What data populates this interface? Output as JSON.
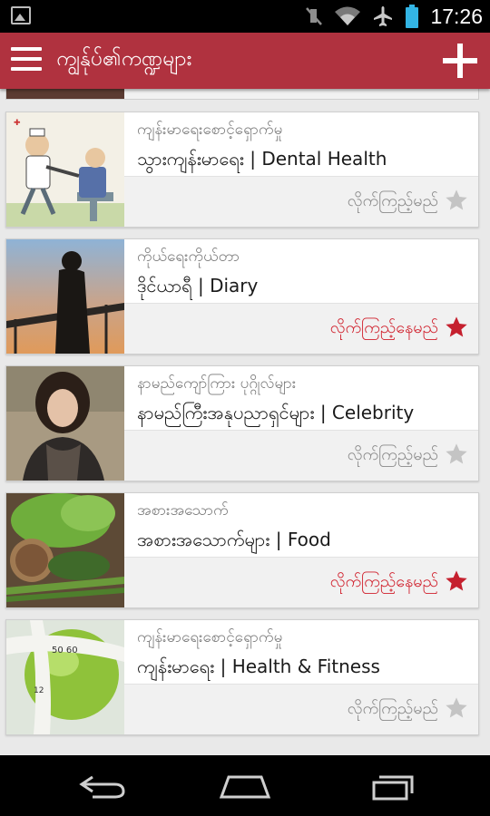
{
  "status_bar": {
    "time": "17:26",
    "icons": [
      "image-icon",
      "mute-icon",
      "wifi-icon",
      "airplane-icon",
      "battery-icon"
    ]
  },
  "app_bar": {
    "title": "ကျွန်ုပ်၏ကဏ္ဍများ",
    "menu_icon": "hamburger-menu-icon",
    "add_icon": "plus-icon"
  },
  "colors": {
    "accent": "#b0323f",
    "followed": "#d0202c",
    "unfollowed": "#8a8a8a",
    "star_on": "#c5202e",
    "star_off": "#c4c4c4"
  },
  "cards": [
    {
      "category": "ကျန်းမာရေးစောင့်ရှောက်မှု",
      "title": "သွားကျန်းမာရေး | Dental Health",
      "action": "လိုက်ကြည့်မည်",
      "starred": false,
      "thumbnail": "dentist-cartoon-image"
    },
    {
      "category": "ကိုယ်ရေးကိုယ်တာ",
      "title": "ဒိုင်ယာရီ | Diary",
      "action": "လိုက်ကြည့်နေမည်",
      "starred": true,
      "thumbnail": "silhouette-phone-image"
    },
    {
      "category": "နာမည်ကျော်ကြား ပုဂ္ဂိုလ်များ",
      "title": "နာမည်ကြီးအနုပညာရှင်များ | Celebrity",
      "action": "လိုက်ကြည့်မည်",
      "starred": false,
      "thumbnail": "celebrity-portrait-image"
    },
    {
      "category": "အစားအသောက်",
      "title": "အစားအသောက်များ | Food",
      "action": "လိုက်ကြည့်နေမည်",
      "starred": true,
      "thumbnail": "vegetables-image"
    },
    {
      "category": "ကျန်းမာရေးစောင့်ရှောက်မှု",
      "title": "ကျန်းမာရေး | Health & Fitness",
      "action": "လိုက်ကြည့်မည်",
      "starred": false,
      "thumbnail": "apple-tape-measure-image"
    }
  ],
  "nav_bar": {
    "buttons": [
      "back-icon",
      "home-icon",
      "recent-apps-icon"
    ]
  }
}
